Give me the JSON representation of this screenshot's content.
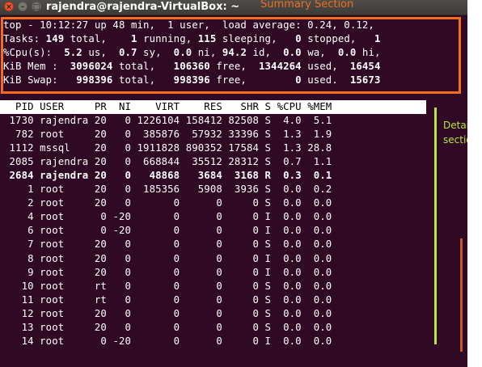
{
  "window": {
    "title": "rajendra@rajendra-VirtualBox: ~",
    "close_glyph": "×",
    "min_glyph": "–",
    "max_glyph": "□"
  },
  "annotations": {
    "summary_label": "Summary Section",
    "detail_label_1": "Detail",
    "detail_label_2": "section",
    "summary_color": "#f06e1e",
    "detail_color": "#b6e83f"
  },
  "colors": {
    "terminal_bg": "#300a24",
    "text": "#ffffff",
    "header_bg": "#ffffff"
  },
  "summary": {
    "line1": "top - 10:12:27 up 48 min,  1 user,  load average: 0.24, 0.12,",
    "tasks": {
      "label": "Tasks:",
      "total": "149",
      "running": "1",
      "sleeping": "115",
      "stopped": "0",
      "zombie": "1"
    },
    "cpu": {
      "label": "%Cpu(s):",
      "us": "5.2",
      "sy": "0.7",
      "ni": "0.0",
      "id": "94.2",
      "wa": "0.0",
      "hi": "0.0"
    },
    "mem": {
      "label": "KiB Mem :",
      "total": "3096024",
      "free": "106360",
      "used": "1344264",
      "buff": "16454"
    },
    "swap": {
      "label": "KiB Swap:",
      "total": "998396",
      "free": "998396",
      "used": "0",
      "avail": "15673"
    }
  },
  "table": {
    "columns": [
      "PID",
      "USER",
      "PR",
      "NI",
      "VIRT",
      "RES",
      "SHR",
      "S",
      "%CPU",
      "%MEM"
    ],
    "rows": [
      [
        "1730",
        "rajendra",
        "20",
        "0",
        "1226104",
        "158412",
        "82508",
        "S",
        "4.0",
        "5.1"
      ],
      [
        "782",
        "root",
        "20",
        "0",
        "385876",
        "57932",
        "33396",
        "S",
        "1.3",
        "1.9"
      ],
      [
        "1112",
        "mssql",
        "20",
        "0",
        "1911828",
        "890352",
        "17584",
        "S",
        "1.3",
        "28.8"
      ],
      [
        "2085",
        "rajendra",
        "20",
        "0",
        "668844",
        "35512",
        "28312",
        "S",
        "0.7",
        "1.1"
      ],
      [
        "2684",
        "rajendra",
        "20",
        "0",
        "48868",
        "3684",
        "3168",
        "R",
        "0.3",
        "0.1"
      ],
      [
        "1",
        "root",
        "20",
        "0",
        "185356",
        "5908",
        "3936",
        "S",
        "0.0",
        "0.2"
      ],
      [
        "2",
        "root",
        "20",
        "0",
        "0",
        "0",
        "0",
        "S",
        "0.0",
        "0.0"
      ],
      [
        "4",
        "root",
        "0",
        "-20",
        "0",
        "0",
        "0",
        "I",
        "0.0",
        "0.0"
      ],
      [
        "6",
        "root",
        "0",
        "-20",
        "0",
        "0",
        "0",
        "I",
        "0.0",
        "0.0"
      ],
      [
        "7",
        "root",
        "20",
        "0",
        "0",
        "0",
        "0",
        "S",
        "0.0",
        "0.0"
      ],
      [
        "8",
        "root",
        "20",
        "0",
        "0",
        "0",
        "0",
        "I",
        "0.0",
        "0.0"
      ],
      [
        "9",
        "root",
        "20",
        "0",
        "0",
        "0",
        "0",
        "I",
        "0.0",
        "0.0"
      ],
      [
        "10",
        "root",
        "rt",
        "0",
        "0",
        "0",
        "0",
        "S",
        "0.0",
        "0.0"
      ],
      [
        "11",
        "root",
        "rt",
        "0",
        "0",
        "0",
        "0",
        "S",
        "0.0",
        "0.0"
      ],
      [
        "12",
        "root",
        "20",
        "0",
        "0",
        "0",
        "0",
        "S",
        "0.0",
        "0.0"
      ],
      [
        "13",
        "root",
        "20",
        "0",
        "0",
        "0",
        "0",
        "S",
        "0.0",
        "0.0"
      ],
      [
        "14",
        "root",
        "0",
        "-20",
        "0",
        "0",
        "0",
        "I",
        "0.0",
        "0.0"
      ]
    ],
    "highlighted_pid": "2684"
  }
}
